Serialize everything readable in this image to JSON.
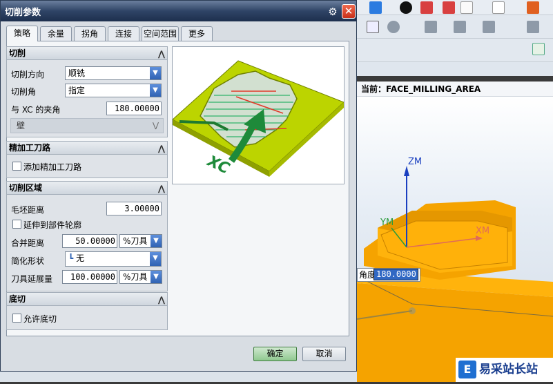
{
  "dialog": {
    "title": "切削参数",
    "tabs": [
      "策略",
      "余量",
      "拐角",
      "连接",
      "空间范围",
      "更多"
    ],
    "active_tab": "策略"
  },
  "groups": {
    "cut": {
      "title": "切削",
      "direction_label": "切削方向",
      "direction_value": "顺铣",
      "angle_label": "切削角",
      "angle_value": "指定",
      "xc_angle_label": "与 XC 的夹角",
      "xc_angle_value": "180.00000",
      "wall_label": "壁"
    },
    "finish": {
      "title": "精加工刀路",
      "add_finish_label": "添加精加工刀路"
    },
    "region": {
      "title": "切削区域",
      "blank_distance_label": "毛坯距离",
      "blank_distance_value": "3.00000",
      "extend_label": "延伸到部件轮廓",
      "merge_label": "合并距离",
      "merge_value": "50.00000",
      "merge_unit": "%刀具",
      "simplify_label": "简化形状",
      "simplify_value": "无",
      "extension_label": "刀具延展量",
      "extension_value": "100.00000",
      "extension_unit": "%刀具"
    },
    "undercut": {
      "title": "底切",
      "allow_label": "允许底切"
    }
  },
  "buttons": {
    "ok": "确定",
    "cancel": "取消"
  },
  "background": {
    "current_label": "当前：FACE_MILLING_AREA",
    "angle_label": "角度",
    "angle_value": "180.0000",
    "axis_zm": "ZM",
    "axis_ym": "YM",
    "axis_xm": "XM",
    "watermark": "易采站长站",
    "watermark_logo": "E"
  }
}
